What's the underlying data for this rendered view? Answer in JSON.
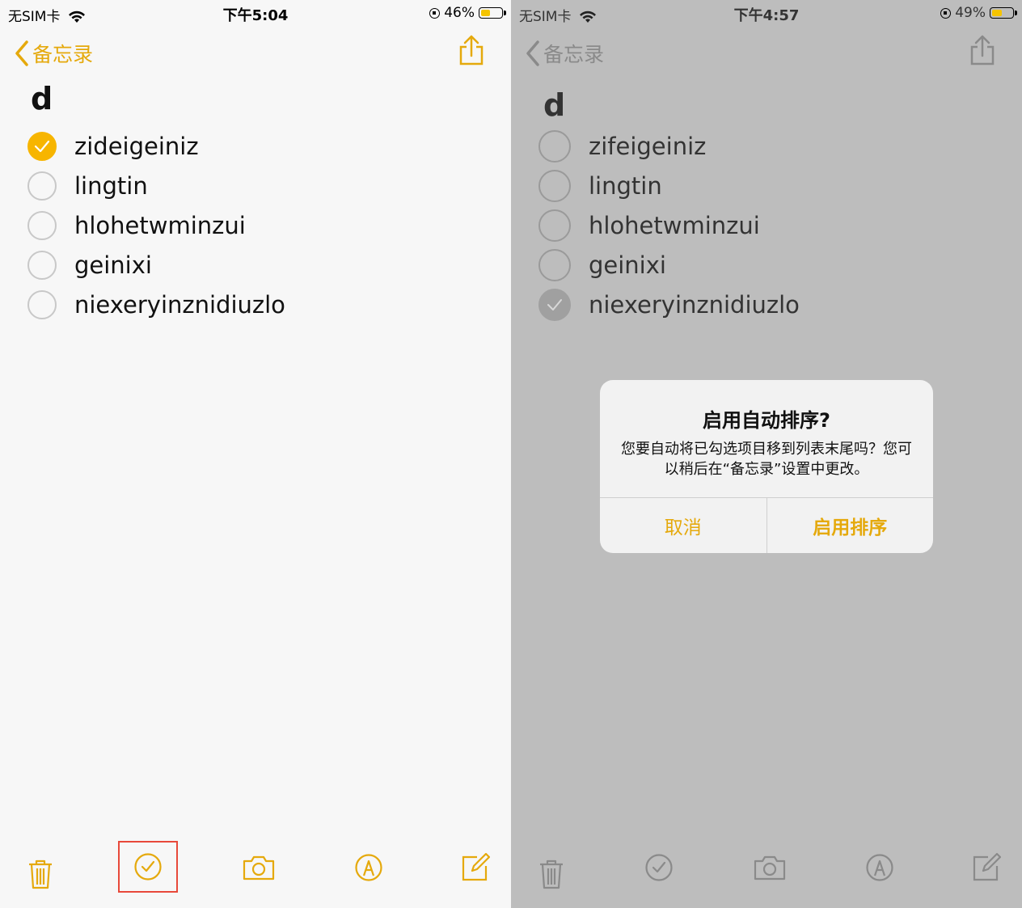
{
  "left": {
    "status": {
      "carrier": "无SIM卡",
      "time": "下午5:04",
      "battery": "46%"
    },
    "nav": {
      "back_label": "备忘录"
    },
    "note": {
      "title": "d",
      "items": [
        {
          "text": "zideigeiniz",
          "checked": true
        },
        {
          "text": "lingtin",
          "checked": false
        },
        {
          "text": "hlohetwminzui",
          "checked": false
        },
        {
          "text": "geinixi",
          "checked": false
        },
        {
          "text": "niexeryinznidiuzlo",
          "checked": false
        }
      ]
    }
  },
  "right": {
    "status": {
      "carrier": "无SIM卡",
      "time": "下午4:57",
      "battery": "49%"
    },
    "nav": {
      "back_label": "备忘录"
    },
    "note": {
      "title": "d",
      "items": [
        {
          "text": "zifeigeiniz",
          "checked": false
        },
        {
          "text": "lingtin",
          "checked": false
        },
        {
          "text": "hlohetwminzui",
          "checked": false
        },
        {
          "text": "geinixi",
          "checked": false
        },
        {
          "text": "niexeryinznidiuzlo",
          "checked": true
        }
      ]
    },
    "dialog": {
      "title": "启用自动排序?",
      "message": "您要自动将已勾选项目移到列表末尾吗？您可以稍后在“备忘录”设置中更改。",
      "cancel": "取消",
      "confirm": "启用排序"
    }
  },
  "colors": {
    "accent": "#e5a90c",
    "check": "#f7b500",
    "highlight": "#e8493a"
  }
}
